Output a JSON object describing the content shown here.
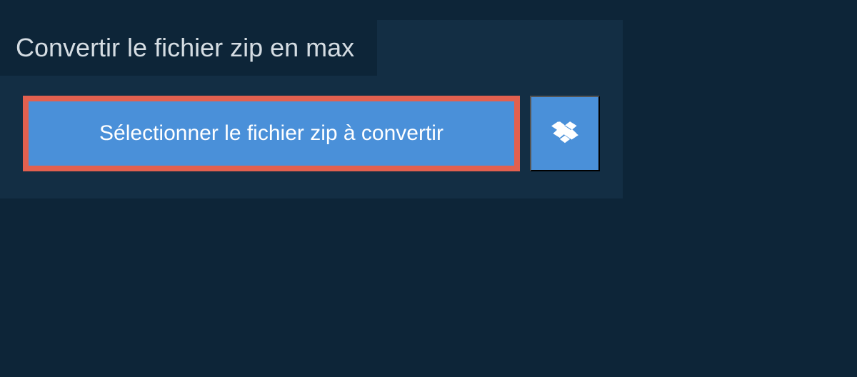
{
  "title": "Convertir le fichier zip en max",
  "selectButton": {
    "label": "Sélectionner le fichier zip à convertir"
  },
  "colors": {
    "background": "#0d2538",
    "panel": "#132e44",
    "buttonBg": "#4a90d9",
    "highlightBorder": "#e2604f",
    "text": "#d5dde3"
  }
}
